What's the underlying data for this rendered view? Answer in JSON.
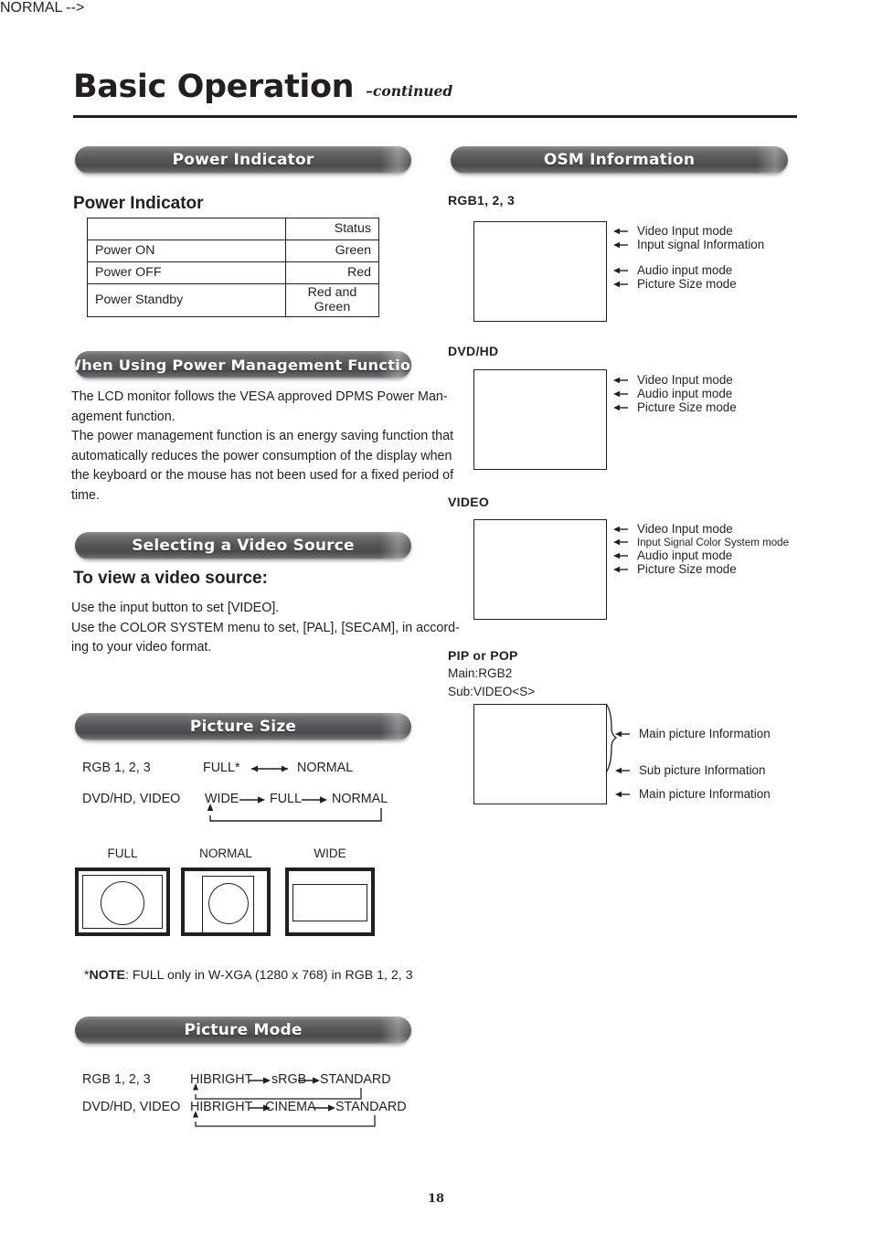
{
  "header": {
    "title": "Basic Operation",
    "continued": "–continued"
  },
  "left_column": {
    "power_indicator": {
      "pill_label": "Power Indicator",
      "heading": "Power Indicator",
      "table": {
        "headers": [
          "",
          "Status"
        ],
        "rows": [
          [
            "Power ON",
            "Green"
          ],
          [
            "Power OFF",
            "Red"
          ],
          [
            "Power Standby",
            "Red and Green"
          ]
        ]
      }
    },
    "power_management": {
      "pill_label": "When Using Power Management Function",
      "paragraph_lines": [
        "The LCD monitor follows the VESA approved DPMS Power Man-",
        "agement function.",
        "The power management function is an energy saving function that",
        "automatically reduces the power consumption of the display when",
        "the keyboard or the mouse has not been used for a fixed period of",
        "time."
      ]
    },
    "video_source": {
      "pill_label": "Selecting a Video Source",
      "heading": "To view a video source:",
      "paragraph_lines": [
        "Use the input button to set [VIDEO].",
        "Use the COLOR SYSTEM menu to set, [PAL], [SECAM], in accord-",
        "ing to your video format."
      ]
    },
    "picture_size": {
      "pill_label": "Picture Size",
      "rows": [
        {
          "source": "RGB 1, 2, 3",
          "items": [
            "FULL*",
            "NORMAL"
          ],
          "arrow": "bidirectional",
          "loopback": false
        },
        {
          "source": "DVD/HD, VIDEO",
          "items": [
            "WIDE",
            "FULL",
            "NORMAL"
          ],
          "arrow": "forward",
          "loopback": true
        }
      ],
      "diagrams": [
        {
          "label": "FULL"
        },
        {
          "label": "NORMAL"
        },
        {
          "label": "WIDE"
        }
      ],
      "note_prefix": "*",
      "note_bold": "NOTE",
      "note_text": ": FULL only in W-XGA (1280 x 768) in RGB 1, 2, 3"
    },
    "picture_mode": {
      "pill_label": "Picture Mode",
      "rows": [
        {
          "source": "RGB 1, 2, 3",
          "items": [
            "HIBRIGHT",
            "sRGB",
            "STANDARD"
          ],
          "loopback": true
        },
        {
          "source": "DVD/HD, VIDEO",
          "items": [
            "HIBRIGHT",
            "CINEMA",
            "STANDARD"
          ],
          "loopback": true
        }
      ]
    }
  },
  "right_column": {
    "osm": {
      "pill_label": "OSM Information",
      "groups": [
        {
          "heading": "RGB1, 2, 3",
          "sublines": [],
          "callouts": [
            "Video Input mode",
            "Input signal Information",
            "Audio input mode",
            "Picture Size mode"
          ],
          "brace": false
        },
        {
          "heading": "DVD/HD",
          "sublines": [],
          "callouts": [
            "Video Input mode",
            "Audio input mode",
            "Picture Size mode"
          ],
          "brace": false
        },
        {
          "heading": "VIDEO",
          "sublines": [],
          "callouts": [
            "Video Input mode",
            "Input Signal Color System mode",
            "Audio input mode",
            "Picture Size mode"
          ],
          "brace": false
        },
        {
          "heading": "PIP or POP",
          "sublines": [
            "Main:RGB2",
            "Sub:VIDEO<S>"
          ],
          "callouts": [
            "Main picture Information",
            "Sub picture Information",
            "Main picture Information"
          ],
          "brace": true
        }
      ]
    }
  },
  "footer": {
    "page_number": "18"
  },
  "colors": {
    "ink": "#231f20",
    "pill_dark": "#4b4b4d",
    "pill_light": "#8e8e8e",
    "paper": "#ffffff"
  }
}
